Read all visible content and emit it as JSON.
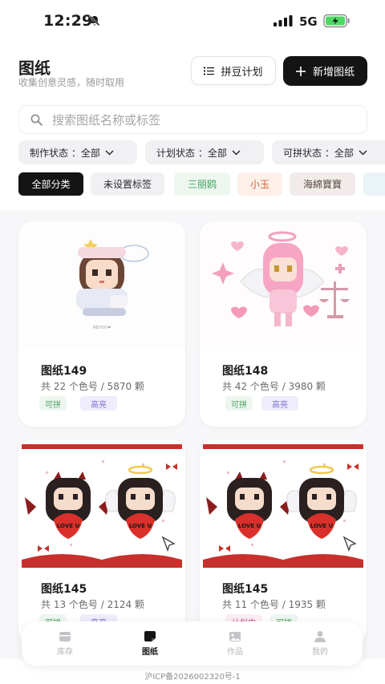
{
  "status_bar": {
    "time": "12:29",
    "network": "5G"
  },
  "header": {
    "title": "图纸",
    "subtitle": "收集创意灵感，随时取用",
    "plan_button": "拼豆计划",
    "new_button": "新增图纸"
  },
  "search": {
    "placeholder": "搜索图纸名称或标签"
  },
  "filters": [
    {
      "label": "制作状态 ：全部"
    },
    {
      "label": "计划状态 ：全部"
    },
    {
      "label": "可拼状态 ：全部"
    }
  ],
  "chips": [
    {
      "label": "全部分类",
      "color": "#ffffff",
      "bg": "#141414"
    },
    {
      "label": "未设置标签",
      "color": "#2a2a2e",
      "bg": "#f1f1f3"
    },
    {
      "label": "三丽鸥",
      "color": "#3f9f5a",
      "bg": "#eef7ef"
    },
    {
      "label": "小玉",
      "color": "#d0653a",
      "bg": "#fdf0e8"
    },
    {
      "label": "海綿寶寶",
      "color": "#5a4a42",
      "bg": "#f1ecea"
    }
  ],
  "cards": [
    {
      "title": "图纸149",
      "meta": "共 22 个色号 / 5870 颗",
      "tags": [
        {
          "label": "可拼",
          "color": "#4e9f62",
          "bg": "#eef7ef"
        },
        {
          "label": "高亮",
          "color": "#7a6fd0",
          "bg": "#efedfb"
        }
      ],
      "image": "doll-pixel-art"
    },
    {
      "title": "图纸148",
      "meta": "共 42 个色号 / 3980 颗",
      "tags": [
        {
          "label": "可拼",
          "color": "#4e9f62",
          "bg": "#eef7ef"
        },
        {
          "label": "高亮",
          "color": "#7a6fd0",
          "bg": "#efedfb"
        }
      ],
      "image": "angel-pixel-art"
    },
    {
      "title": "图纸145",
      "meta": "共 13 个色号 / 2124 颗",
      "tags": [
        {
          "label": "可拼",
          "color": "#4e9f62",
          "bg": "#eef7ef"
        },
        {
          "label": "高亮",
          "color": "#7a6fd0",
          "bg": "#efedfb"
        }
      ],
      "image": "devil-angel-pixel-art",
      "love_text": "LOVE U"
    },
    {
      "title": "图纸145",
      "meta": "共 11 个色号 / 1935 颗",
      "tags": [
        {
          "label": "计划中",
          "color": "#c9568f",
          "bg": "#fbeef5"
        },
        {
          "label": "可拼",
          "color": "#4e9f62",
          "bg": "#eef7ef"
        }
      ],
      "image": "devil-angel-pixel-art",
      "love_text": "LOVE U"
    }
  ],
  "tabs": [
    {
      "label": "库存",
      "icon": "inventory-icon",
      "active": false
    },
    {
      "label": "图纸",
      "icon": "drawing-icon",
      "active": true
    },
    {
      "label": "作品",
      "icon": "image-icon",
      "active": false
    },
    {
      "label": "我的",
      "icon": "user-icon",
      "active": false
    }
  ],
  "footer": {
    "icp": "沪ICP备2026002320号-1"
  },
  "colors": {
    "accent": "#141414",
    "background": "#f7f7f9"
  }
}
